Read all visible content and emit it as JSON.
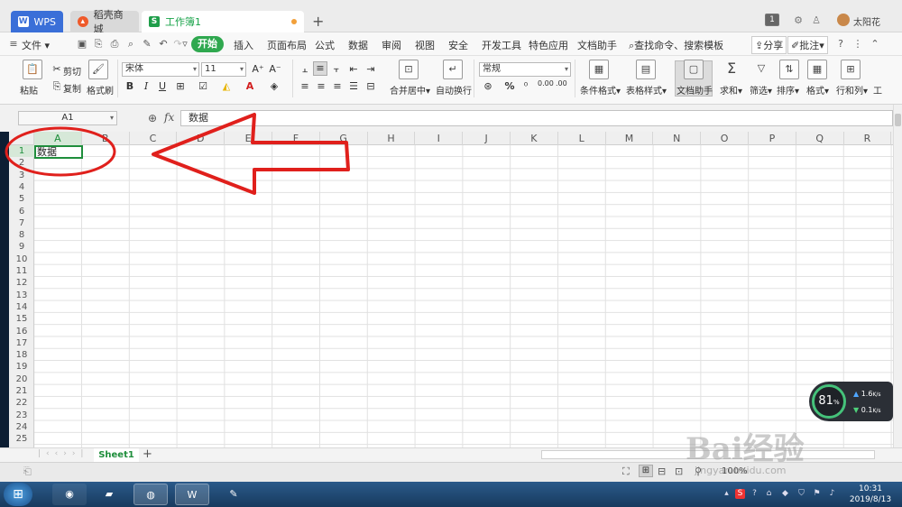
{
  "titlebar": {
    "tabs": [
      {
        "label": "WPS",
        "icon": "wps-logo-icon"
      },
      {
        "label": "稻壳商城",
        "icon": "flame-icon"
      },
      {
        "label": "工作簿1",
        "icon": "spreadsheet-icon",
        "active": true
      }
    ],
    "page_number": "1",
    "user_name": "太阳花"
  },
  "menubar": {
    "file": "文件",
    "items": [
      "开始",
      "插入",
      "页面布局",
      "公式",
      "数据",
      "审阅",
      "视图",
      "安全",
      "开发工具",
      "特色应用",
      "文档助手"
    ],
    "search": "查找命令、搜索模板",
    "share": "分享",
    "comment": "批注",
    "accent_color": "#2fa84f"
  },
  "ribbon": {
    "paste": "粘贴",
    "cut": "剪切",
    "copy": "复制",
    "format_painter": "格式刷",
    "font_name": "宋体",
    "font_size": "11",
    "number_format": "常规",
    "merge_center": "合并居中",
    "wrap_text": "自动换行",
    "percent_symbol": "%",
    "decrease_decimal": "0.00",
    "increase_decimal": ".00",
    "conditional_format": "条件格式",
    "table_style": "表格样式",
    "doc_assistant": "文档助手",
    "sum": "求和",
    "filter": "筛选",
    "sort": "排序",
    "format": "格式",
    "rows_cols": "行和列",
    "worksheet": "工"
  },
  "formula_bar": {
    "name_box": "A1",
    "fx_label": "fx",
    "value": "数据"
  },
  "grid": {
    "columns": [
      "A",
      "B",
      "C",
      "D",
      "E",
      "F",
      "G",
      "H",
      "I",
      "J",
      "K",
      "L",
      "M",
      "N",
      "O",
      "P",
      "Q",
      "R"
    ],
    "rows": [
      "1",
      "2",
      "3",
      "4",
      "5",
      "6",
      "7",
      "8",
      "9",
      "10",
      "11",
      "12",
      "13",
      "14",
      "15",
      "16",
      "17",
      "18",
      "19",
      "20",
      "21",
      "22",
      "23",
      "24",
      "25"
    ],
    "active_cell": "A1",
    "active_cell_value": "数据"
  },
  "sheets": {
    "tabs": [
      "Sheet1"
    ],
    "active": "Sheet1"
  },
  "statusbar": {
    "zoom": "100%"
  },
  "net_widget": {
    "percent": "81",
    "percent_unit": "%",
    "upload": "1.6",
    "download": "0.1",
    "rate_unit": "K/s"
  },
  "taskbar": {
    "time": "10:31",
    "date": "2019/8/13"
  },
  "watermark": {
    "text": "Bai经验",
    "url_text": "jingyan.baidu.com"
  },
  "annotation": {
    "color": "#e0201c"
  }
}
